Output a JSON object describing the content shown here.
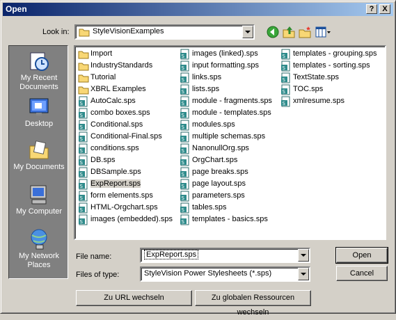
{
  "window": {
    "title": "Open",
    "help_label": "?",
    "close_label": "X"
  },
  "lookin": {
    "label": "Look in:",
    "value": "StyleVisionExamples"
  },
  "places": [
    {
      "label": "My Recent Documents",
      "icon": "recent-documents-icon"
    },
    {
      "label": "Desktop",
      "icon": "desktop-icon"
    },
    {
      "label": "My Documents",
      "icon": "my-documents-icon"
    },
    {
      "label": "My Computer",
      "icon": "my-computer-icon"
    },
    {
      "label": "My Network Places",
      "icon": "network-places-icon"
    }
  ],
  "files": {
    "col1": [
      {
        "name": "Import",
        "type": "folder"
      },
      {
        "name": "IndustryStandards",
        "type": "folder"
      },
      {
        "name": "Tutorial",
        "type": "folder"
      },
      {
        "name": "XBRL Examples",
        "type": "folder"
      },
      {
        "name": "AutoCalc.sps",
        "type": "sps"
      },
      {
        "name": "combo boxes.sps",
        "type": "sps"
      },
      {
        "name": "Conditional.sps",
        "type": "sps"
      },
      {
        "name": "Conditional-Final.sps",
        "type": "sps"
      },
      {
        "name": "conditions.sps",
        "type": "sps"
      },
      {
        "name": "DB.sps",
        "type": "sps"
      },
      {
        "name": "DBSample.sps",
        "type": "sps"
      },
      {
        "name": "ExpReport.sps",
        "type": "sps",
        "selected": true
      },
      {
        "name": "form elements.sps",
        "type": "sps"
      },
      {
        "name": "HTML-Orgchart.sps",
        "type": "sps"
      },
      {
        "name": "images (embedded).sps",
        "type": "sps"
      }
    ],
    "col2": [
      {
        "name": "images (linked).sps",
        "type": "sps"
      },
      {
        "name": "input formatting.sps",
        "type": "sps"
      },
      {
        "name": "links.sps",
        "type": "sps"
      },
      {
        "name": "lists.sps",
        "type": "sps"
      },
      {
        "name": "module - fragments.sps",
        "type": "sps"
      },
      {
        "name": "module - templates.sps",
        "type": "sps"
      },
      {
        "name": "modules.sps",
        "type": "sps"
      },
      {
        "name": "multiple schemas.sps",
        "type": "sps"
      },
      {
        "name": "NanonullOrg.sps",
        "type": "sps"
      },
      {
        "name": "OrgChart.sps",
        "type": "sps"
      },
      {
        "name": "page breaks.sps",
        "type": "sps"
      },
      {
        "name": "page layout.sps",
        "type": "sps"
      },
      {
        "name": "parameters.sps",
        "type": "sps"
      },
      {
        "name": "tables.sps",
        "type": "sps"
      },
      {
        "name": "templates - basics.sps",
        "type": "sps"
      }
    ],
    "col3": [
      {
        "name": "templates - grouping.sps",
        "type": "sps"
      },
      {
        "name": "templates - sorting.sps",
        "type": "sps"
      },
      {
        "name": "TextState.sps",
        "type": "sps"
      },
      {
        "name": "TOC.sps",
        "type": "sps"
      },
      {
        "name": "xmlresume.sps",
        "type": "sps"
      }
    ]
  },
  "filename": {
    "label": "File name:",
    "value": "ExpReport.sps"
  },
  "filetype": {
    "label": "Files of type:",
    "value": "StyleVision Power Stylesheets (*.sps)"
  },
  "buttons": {
    "open": "Open",
    "cancel": "Cancel",
    "url": "Zu URL wechseln",
    "global": "Zu globalen Ressourcen wechseln"
  },
  "colors": {
    "title_start": "#0a246a",
    "title_end": "#a6caf0",
    "places_bg": "#808080",
    "face": "#d4d0c8"
  }
}
